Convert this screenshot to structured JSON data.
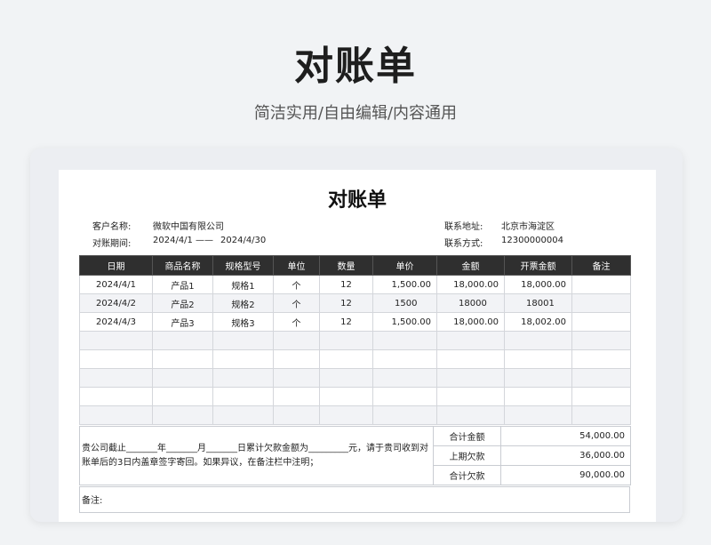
{
  "header": {
    "title": "对账单",
    "subtitle": "简洁实用/自由编辑/内容通用"
  },
  "sheet": {
    "title": "对账单",
    "customer_label": "客户名称:",
    "customer_value": "微软中国有限公司",
    "period_label": "对账期间:",
    "period_start": "2024/4/1",
    "period_sep": "——",
    "period_end": "2024/4/30",
    "address_label": "联系地址:",
    "address_value": "北京市海淀区",
    "contact_label": "联系方式:",
    "contact_value": "12300000004"
  },
  "table": {
    "headers": [
      "日期",
      "商品名称",
      "规格型号",
      "单位",
      "数量",
      "单价",
      "金额",
      "开票金额",
      "备注"
    ],
    "rows": [
      [
        "2024/4/1",
        "产品1",
        "规格1",
        "个",
        "12",
        "1,500.00",
        "18,000.00",
        "18,000.00",
        ""
      ],
      [
        "2024/4/2",
        "产品2",
        "规格2",
        "个",
        "12",
        "1500",
        "18000",
        "18001",
        ""
      ],
      [
        "2024/4/3",
        "产品3",
        "规格3",
        "个",
        "12",
        "1,500.00",
        "18,000.00",
        "18,002.00",
        ""
      ],
      [
        "",
        "",
        "",
        "",
        "",
        "",
        "",
        "",
        ""
      ],
      [
        "",
        "",
        "",
        "",
        "",
        "",
        "",
        "",
        ""
      ],
      [
        "",
        "",
        "",
        "",
        "",
        "",
        "",
        "",
        ""
      ],
      [
        "",
        "",
        "",
        "",
        "",
        "",
        "",
        "",
        ""
      ],
      [
        "",
        "",
        "",
        "",
        "",
        "",
        "",
        "",
        ""
      ]
    ]
  },
  "summary": {
    "statement": "贵公司截止_______年_______月_______日累计欠款金额为_________元，请于贵司收到对账单后的3日内盖章签字寄回。如果异议，在备注栏中注明；",
    "total_label": "合计金额",
    "total_value": "54,000.00",
    "prev_label": "上期欠款",
    "prev_value": "36,000.00",
    "owed_label": "合计欠款",
    "owed_value": "90,000.00"
  },
  "remark": {
    "label": "备注:"
  }
}
